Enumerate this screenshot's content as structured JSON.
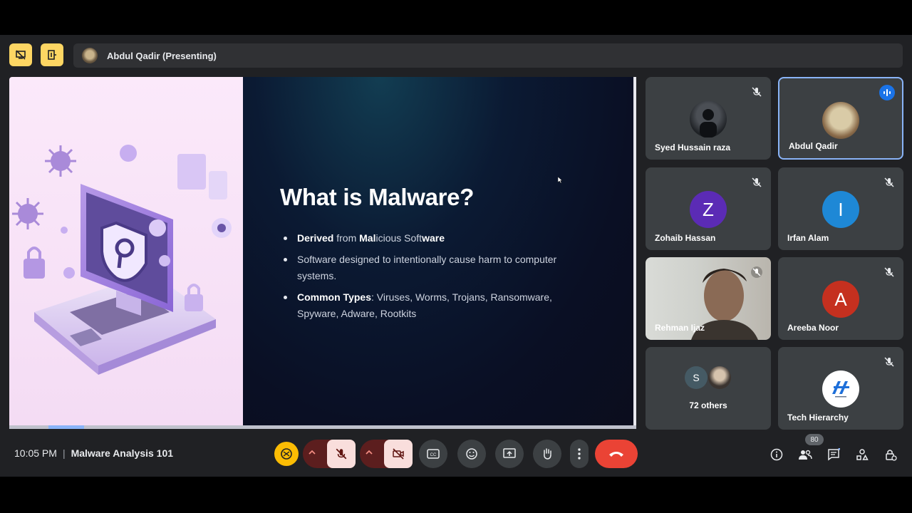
{
  "presenter_bar": {
    "label": "Abdul Qadir (Presenting)"
  },
  "slide": {
    "title": "What is Malware?",
    "bullets": [
      {
        "bold_prefix": "Derived",
        "text_parts": [
          "from ",
          "Mal",
          "icious Soft",
          "ware"
        ]
      },
      {
        "text": "Software designed to intentionally cause harm to computer systems."
      },
      {
        "bold_prefix": "Common Types",
        "text": ": Viruses, Worms, Trojans, Ransomware, Spyware, Adware, Rootkits"
      }
    ],
    "slide_progress": 0.1
  },
  "participants": [
    {
      "name": "Syed Hussain raza",
      "avatar": "photo",
      "muted": true
    },
    {
      "name": "Abdul Qadir",
      "avatar": "photo",
      "muted": false,
      "speaking": true
    },
    {
      "name": "Zohaib Hassan",
      "initial": "Z",
      "color": "#5b2bb5",
      "muted": true
    },
    {
      "name": "Irfan Alam",
      "initial": "I",
      "color": "#1e88d6",
      "muted": true
    },
    {
      "name": "Rehman Ijaz",
      "avatar": "video",
      "muted": true
    },
    {
      "name": "Areeba Noor",
      "initial": "A",
      "color": "#c5301f",
      "muted": true
    },
    {
      "name": "72 others",
      "initial": "S",
      "color": "#455a64"
    },
    {
      "name": "Tech Hierarchy",
      "avatar": "logo",
      "muted": true
    }
  ],
  "bottom_bar": {
    "time": "10:05 PM",
    "meeting_title": "Malware Analysis 101",
    "people_count": "80"
  },
  "colors": {
    "end_call": "#ea4335",
    "muted_red": "#f9dedc",
    "accent_yellow": "#fdd663"
  }
}
